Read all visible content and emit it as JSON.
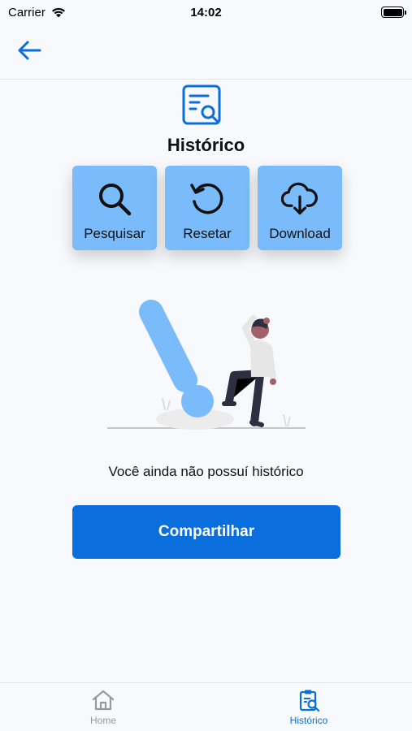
{
  "status_bar": {
    "carrier": "Carrier",
    "time": "14:02"
  },
  "header": {
    "back_icon": "arrow-left-icon",
    "page_icon": "document-search-icon",
    "title": "Histórico"
  },
  "actions": [
    {
      "label": "Pesquisar",
      "icon": "search-icon"
    },
    {
      "label": "Resetar",
      "icon": "reset-icon"
    },
    {
      "label": "Download",
      "icon": "cloud-download-icon"
    }
  ],
  "empty_state": {
    "message": "Você ainda não possuí histórico"
  },
  "share_button": {
    "label": "Compartilhar"
  },
  "tab_bar": {
    "tabs": [
      {
        "label": "Home",
        "icon": "home-icon",
        "active": false
      },
      {
        "label": "Histórico",
        "icon": "history-icon",
        "active": true
      }
    ]
  },
  "colors": {
    "accent": "#0a6fdc",
    "action_button_bg": "#79bbfb",
    "background": "#f7f9fc"
  }
}
